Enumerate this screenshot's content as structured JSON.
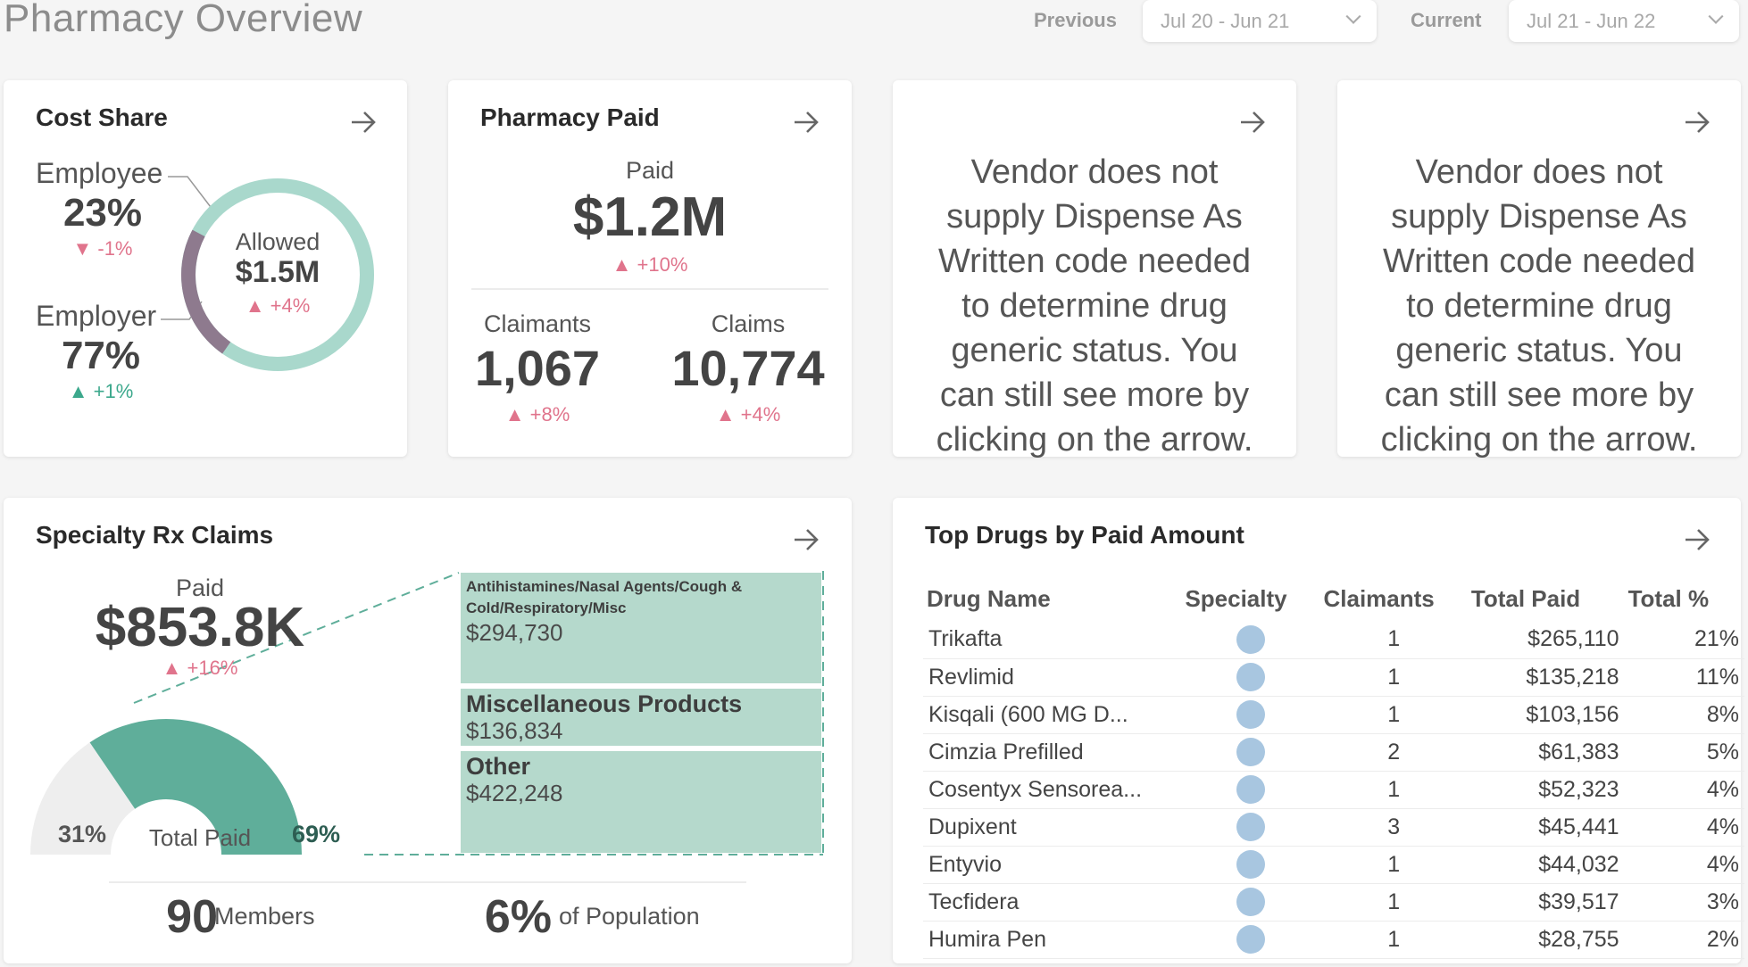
{
  "header": {
    "title": "Pharmacy Overview",
    "previous_label": "Previous",
    "previous_value": "Jul 20 - Jun 21",
    "current_label": "Current",
    "current_value": "Jul 21 - Jun 22"
  },
  "cost_share": {
    "title": "Cost Share",
    "employee_label": "Employee",
    "employee_pct": "23%",
    "employee_delta": "▼ -1%",
    "employer_label": "Employer",
    "employer_pct": "77%",
    "employer_delta": "▲ +1%",
    "allowed_label": "Allowed",
    "allowed_value": "$1.5M",
    "allowed_delta": "▲ +4%",
    "employee_fraction": 0.23
  },
  "pharmacy_paid": {
    "title": "Pharmacy Paid",
    "paid_label": "Paid",
    "paid_value": "$1.2M",
    "paid_delta": "▲ +10%",
    "claimants_label": "Claimants",
    "claimants_value": "1,067",
    "claimants_delta": "▲ +8%",
    "claims_label": "Claims",
    "claims_value": "10,774",
    "claims_delta": "▲ +4%"
  },
  "vendor_notes": [
    {
      "text": "Vendor does not supply Dispense As Written code needed to determine drug generic status. You can still see more by clicking on the arrow."
    },
    {
      "text": "Vendor does not supply Dispense As Written code needed to determine drug generic status. You can still see more by clicking on the arrow."
    }
  ],
  "specialty": {
    "title": "Specialty Rx Claims",
    "paid_label": "Paid",
    "paid_value": "$853.8K",
    "paid_delta": "▲ +16%",
    "non_specialty_pct": "31%",
    "specialty_pct": "69%",
    "gauge_label": "Total Paid",
    "specialty_fraction": 0.69,
    "members_value": "90",
    "members_label": "Members",
    "population_value": "6%",
    "population_label": "of Population",
    "categories": [
      {
        "name": "Antihistamines/Nasal Agents/Cough & Cold/Respiratory/Misc",
        "value": "$294,730"
      },
      {
        "name": "Miscellaneous Products",
        "value": "$136,834"
      },
      {
        "name": "Other",
        "value": "$422,248"
      }
    ]
  },
  "top_drugs": {
    "title": "Top Drugs by Paid Amount",
    "columns": [
      "Drug Name",
      "Specialty",
      "Claimants",
      "Total Paid",
      "Total %"
    ],
    "rows": [
      {
        "name": "Trikafta",
        "claimants": "1",
        "paid": "$265,110",
        "pct": "21%"
      },
      {
        "name": "Revlimid",
        "claimants": "1",
        "paid": "$135,218",
        "pct": "11%"
      },
      {
        "name": "Kisqali (600 MG D...",
        "claimants": "1",
        "paid": "$103,156",
        "pct": "8%"
      },
      {
        "name": "Cimzia Prefilled",
        "claimants": "2",
        "paid": "$61,383",
        "pct": "5%"
      },
      {
        "name": "Cosentyx Sensorea...",
        "claimants": "1",
        "paid": "$52,323",
        "pct": "4%"
      },
      {
        "name": "Dupixent",
        "claimants": "3",
        "paid": "$45,441",
        "pct": "4%"
      },
      {
        "name": "Entyvio",
        "claimants": "1",
        "paid": "$44,032",
        "pct": "4%"
      },
      {
        "name": "Tecfidera",
        "claimants": "1",
        "paid": "$39,517",
        "pct": "3%"
      },
      {
        "name": "Humira Pen",
        "claimants": "1",
        "paid": "$28,755",
        "pct": "2%"
      }
    ]
  },
  "colors": {
    "teal": "#5fae9a",
    "teal_light": "#a9d8cc",
    "mauve": "#8e7a8e",
    "red": "#e0748c",
    "green": "#3ca88c",
    "dot": "#a8c6e0",
    "tile": "#b5d9cc"
  }
}
